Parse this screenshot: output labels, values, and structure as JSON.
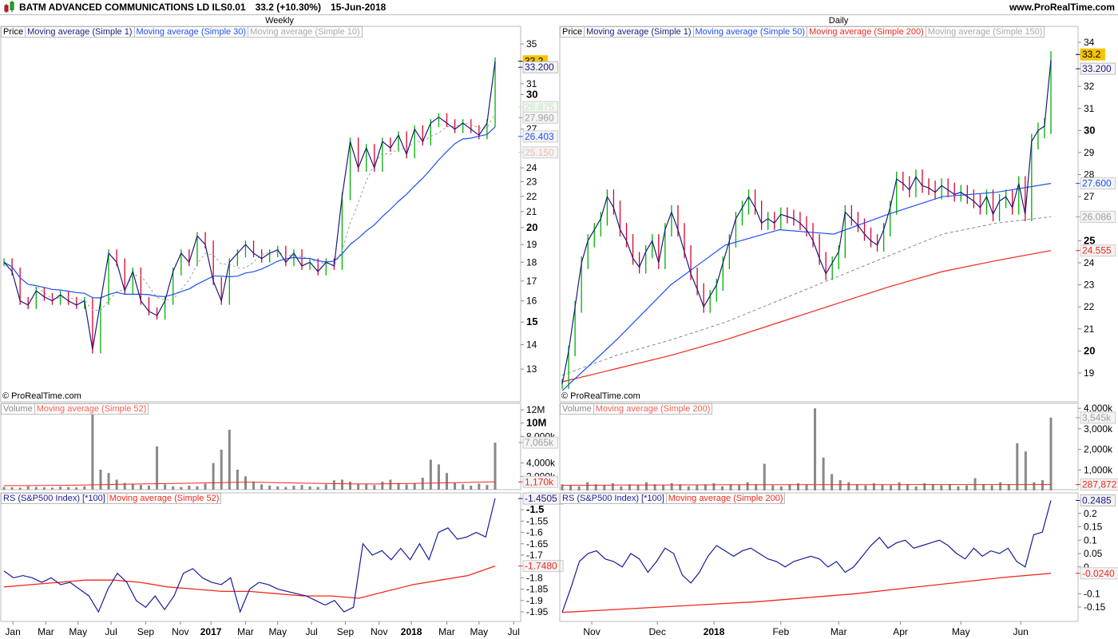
{
  "header": {
    "title": "BATM ADVANCED COMMUNICATIONS LD ILS0.01",
    "price": "33.2 (+10.30%)",
    "date": "15-Jun-2018",
    "site": "www.ProRealTime.com"
  },
  "copyright": "© ProRealTime.com",
  "colors": {
    "up": "#00b000",
    "down": "#e0002a",
    "ma1": "#1a1a80",
    "blue": "#1f4ff0",
    "red": "#f0281e",
    "gray": "#a0a0a0",
    "badge_last": "#f5c400"
  },
  "chart_data": [
    {
      "type": "line",
      "title": "Weekly",
      "legend": {
        "price": "Price",
        "ma1": "Moving average (Simple 1)",
        "ma_a": "Moving average (Simple 30)",
        "ma_b": "Moving average (Simple 10)"
      },
      "vol_legend": {
        "vol": "Volume",
        "ma": "Moving average (Simple 52)"
      },
      "rs_legend": {
        "rs": "RS (S&P500 Index) [*100]",
        "ma": "Moving average (Simple 52)"
      },
      "closes": [
        18,
        17.5,
        16,
        15.8,
        16.5,
        16.2,
        16,
        16.3,
        16,
        15.8,
        16,
        13.8,
        16,
        18.5,
        18,
        16.5,
        17.5,
        16,
        15.5,
        15.3,
        16,
        17.5,
        18.5,
        18,
        19.5,
        19,
        17,
        16,
        18,
        18.5,
        19,
        18.5,
        18.2,
        18.5,
        18.7,
        18,
        18.5,
        17.8,
        18,
        17.5,
        18,
        17.8,
        22,
        26,
        24,
        25.5,
        24,
        26,
        25.5,
        26.5,
        25,
        27,
        26,
        27.5,
        28,
        27.5,
        27,
        27.5,
        27,
        26.5,
        27.5,
        33.2
      ],
      "ma_a_window": 15,
      "ma_b_window": 5,
      "volume": [
        400,
        350,
        300,
        500,
        400,
        350,
        300,
        450,
        400,
        350,
        500,
        12000,
        3000,
        2500,
        1500,
        1000,
        900,
        700,
        600,
        6500,
        800,
        500,
        400,
        600,
        500,
        900,
        4000,
        6000,
        9000,
        3000,
        2000,
        1200,
        800,
        600,
        500,
        400,
        600,
        700,
        500,
        400,
        800,
        1400,
        1500,
        1200,
        900,
        800,
        700,
        1200,
        1500,
        1000,
        800,
        900,
        1800,
        4500,
        3800,
        2500,
        1000,
        800,
        600,
        900,
        700,
        7065
      ],
      "vol_ma": [
        600,
        600,
        620,
        650,
        700,
        750,
        800,
        850,
        900,
        950,
        1000,
        1050,
        1100,
        1100,
        1050,
        1000,
        950,
        900,
        850,
        850,
        900,
        950,
        1000,
        1050,
        1100,
        1170
      ],
      "rs": [
        -1.77,
        -1.8,
        -1.79,
        -1.8,
        -1.82,
        -1.8,
        -1.83,
        -1.82,
        -1.85,
        -1.88,
        -1.95,
        -1.85,
        -1.78,
        -1.82,
        -1.9,
        -1.93,
        -1.88,
        -1.94,
        -1.88,
        -1.78,
        -1.76,
        -1.8,
        -1.82,
        -1.83,
        -1.8,
        -1.95,
        -1.85,
        -1.82,
        -1.83,
        -1.85,
        -1.86,
        -1.87,
        -1.88,
        -1.9,
        -1.92,
        -1.9,
        -1.95,
        -1.93,
        -1.65,
        -1.7,
        -1.68,
        -1.72,
        -1.67,
        -1.72,
        -1.65,
        -1.72,
        -1.6,
        -1.58,
        -1.63,
        -1.62,
        -1.6,
        -1.62,
        -1.45
      ],
      "rs_ma": [
        -1.84,
        -1.83,
        -1.82,
        -1.81,
        -1.81,
        -1.82,
        -1.84,
        -1.85,
        -1.86,
        -1.86,
        -1.87,
        -1.88,
        -1.88,
        -1.89,
        -1.86,
        -1.83,
        -1.81,
        -1.79,
        -1.748
      ],
      "price_ticks": [
        {
          "v": 35,
          "label": "35"
        },
        {
          "v": 31,
          "label": "31"
        },
        {
          "v": 30,
          "label": "30",
          "bold": true
        },
        {
          "v": 27,
          "label": "27"
        },
        {
          "v": 24,
          "label": "24"
        },
        {
          "v": 23,
          "label": "23"
        },
        {
          "v": 22,
          "label": "22"
        },
        {
          "v": 21,
          "label": "21"
        },
        {
          "v": 20,
          "label": "20",
          "bold": true
        },
        {
          "v": 19,
          "label": "19"
        },
        {
          "v": 18,
          "label": "18"
        },
        {
          "v": 17,
          "label": "17"
        },
        {
          "v": 16,
          "label": "16"
        },
        {
          "v": 15,
          "label": "15",
          "bold": true
        },
        {
          "v": 14,
          "label": "14"
        },
        {
          "v": 13,
          "label": "13"
        }
      ],
      "vol_ticks": [
        {
          "v": 12000,
          "label": "12M"
        },
        {
          "v": 10000,
          "label": "10M",
          "bold": true
        },
        {
          "v": 8000,
          "label": "8,000k"
        },
        {
          "v": 4000,
          "label": "4,000k"
        },
        {
          "v": 2000,
          "label": "2,000k"
        }
      ],
      "rs_ticks": [
        {
          "v": -1.5,
          "label": "-1.5",
          "bold": true
        },
        {
          "v": -1.55,
          "label": "-1.55"
        },
        {
          "v": -1.6,
          "label": "-1.6"
        },
        {
          "v": -1.65,
          "label": "-1.65"
        },
        {
          "v": -1.7,
          "label": "-1.7"
        },
        {
          "v": -1.8,
          "label": "-1.8"
        },
        {
          "v": -1.85,
          "label": "-1.85"
        },
        {
          "v": -1.9,
          "label": "-1.9"
        },
        {
          "v": -1.95,
          "label": "-1.95"
        }
      ],
      "price_badges": [
        {
          "v": 33.2,
          "label": "33.2",
          "kind": "last"
        },
        {
          "v": 32.6,
          "label": "33.200",
          "kind": "ma1"
        },
        {
          "v": 28.875,
          "label": "28.875",
          "kind": "green"
        },
        {
          "v": 27.96,
          "label": "27.960",
          "kind": "gray"
        },
        {
          "v": 26.403,
          "label": "26.403",
          "kind": "blue"
        },
        {
          "v": 25.15,
          "label": "25.150",
          "kind": "pink"
        }
      ],
      "vol_badges": [
        {
          "v": 7065,
          "label": "7,065k",
          "kind": "gray"
        },
        {
          "v": 1170,
          "label": "1,170k",
          "kind": "red"
        }
      ],
      "rs_badges": [
        {
          "v": -1.4505,
          "label": "-1.4505",
          "kind": "ma1"
        },
        {
          "v": -1.748,
          "label": "-1.7480",
          "kind": "red"
        }
      ],
      "x_labels": [
        {
          "at": 1.1,
          "label": "Jan"
        },
        {
          "at": 5.2,
          "label": "Mar"
        },
        {
          "at": 9.2,
          "label": "May"
        },
        {
          "at": 13.3,
          "label": "Jul"
        },
        {
          "at": 17.6,
          "label": "Sep"
        },
        {
          "at": 21.9,
          "label": "Nov"
        },
        {
          "at": 25.7,
          "label": "2017",
          "bold": true
        },
        {
          "at": 30,
          "label": "Mar"
        },
        {
          "at": 34,
          "label": "May"
        },
        {
          "at": 38.2,
          "label": "Jul"
        },
        {
          "at": 42.4,
          "label": "Sep"
        },
        {
          "at": 46.6,
          "label": "Nov"
        },
        {
          "at": 50.6,
          "label": "2018",
          "bold": true
        },
        {
          "at": 55,
          "label": "Mar"
        },
        {
          "at": 59,
          "label": "May"
        },
        {
          "at": 63.3,
          "label": "Jul"
        }
      ]
    },
    {
      "type": "line",
      "title": "Daily",
      "legend": {
        "price": "Price",
        "ma1": "Moving average (Simple 1)",
        "ma_a": "Moving average (Simple 50)",
        "ma_c": "Moving average (Simple 200)",
        "ma_b": "Moving average (Simple 150)"
      },
      "vol_legend": {
        "vol": "Volume",
        "ma": "Moving average (Simple 200)"
      },
      "rs_legend": {
        "rs": "RS (S&P500 Index) [*100]",
        "ma": "Moving average (Simple 200)"
      },
      "closes": [
        18.5,
        20,
        22,
        24,
        25,
        25.5,
        26,
        27,
        26.5,
        25.5,
        25,
        24.2,
        23.8,
        24.5,
        25,
        24,
        25.5,
        26.3,
        25.5,
        24.5,
        23.5,
        22.8,
        22,
        22.5,
        23,
        24,
        25,
        26,
        26.5,
        27,
        26.5,
        25.8,
        26,
        25.8,
        26.2,
        26.1,
        26,
        25.8,
        25.5,
        25,
        24.2,
        23.5,
        24,
        24.5,
        26.3,
        26,
        25.7,
        25.3,
        25,
        24.8,
        25.5,
        26.5,
        27.8,
        27.6,
        27.3,
        27.9,
        27.5,
        27.4,
        27.2,
        27.5,
        27.3,
        27.1,
        27.2,
        27,
        26.8,
        26.5,
        27,
        26.2,
        26.8,
        27,
        26.5,
        27.6,
        26.2,
        29.5,
        30,
        30.2,
        33.2
      ],
      "ma_a": [
        18.2,
        20.5,
        23,
        24.8,
        25.5,
        25.3,
        26.2,
        27.0,
        27.2,
        27.6
      ],
      "ma_b": [
        18.9,
        19.8,
        20.5,
        21.3,
        22.3,
        23.3,
        24.3,
        25.3,
        25.8,
        26.086
      ],
      "ma_c": [
        18.6,
        19.2,
        19.8,
        20.5,
        21.3,
        22.1,
        22.9,
        23.6,
        24.1,
        24.555
      ],
      "volume": [
        300,
        250,
        200,
        400,
        300,
        250,
        350,
        200,
        300,
        250,
        400,
        300,
        250,
        350,
        300,
        200,
        250,
        300,
        350,
        200,
        300,
        250,
        400,
        300,
        1300,
        250,
        200,
        300,
        350,
        300,
        4000,
        1600,
        800,
        500,
        400,
        300,
        250,
        350,
        300,
        250,
        400,
        300,
        200,
        350,
        300,
        250,
        300,
        200,
        250,
        600,
        300,
        250,
        400,
        300,
        2300,
        1900,
        400,
        500,
        3545
      ],
      "vol_ma": [
        250,
        260,
        270,
        275,
        280,
        282,
        285,
        286,
        287,
        287.872
      ],
      "rs": [
        -0.17,
        -0.08,
        0.02,
        0.05,
        0.06,
        0.03,
        0.02,
        0.0,
        0.05,
        0.03,
        -0.02,
        0.02,
        0.07,
        0.05,
        -0.03,
        -0.06,
        -0.02,
        0.04,
        0.08,
        0.06,
        0.04,
        0.06,
        0.07,
        0.05,
        0.03,
        0.02,
        0.0,
        0.02,
        0.03,
        0.04,
        0.03,
        0.0,
        0.02,
        -0.02,
        0.0,
        0.04,
        0.08,
        0.11,
        0.07,
        0.09,
        0.1,
        0.07,
        0.08,
        0.09,
        0.1,
        0.08,
        0.05,
        0.03,
        0.07,
        0.04,
        0.06,
        0.05,
        0.07,
        0.02,
        0.0,
        0.12,
        0.13,
        0.2485
      ],
      "rs_ma": [
        -0.17,
        -0.16,
        -0.15,
        -0.14,
        -0.13,
        -0.115,
        -0.1,
        -0.08,
        -0.06,
        -0.04,
        -0.024
      ],
      "price_ticks": [
        {
          "v": 34,
          "label": "34"
        },
        {
          "v": 32,
          "label": "32"
        },
        {
          "v": 31,
          "label": "31"
        },
        {
          "v": 30,
          "label": "30",
          "bold": true
        },
        {
          "v": 29,
          "label": "29"
        },
        {
          "v": 28,
          "label": "28"
        },
        {
          "v": 27,
          "label": "27"
        },
        {
          "v": 25,
          "label": "25",
          "bold": true
        },
        {
          "v": 24,
          "label": "24"
        },
        {
          "v": 23,
          "label": "23"
        },
        {
          "v": 22,
          "label": "22"
        },
        {
          "v": 21,
          "label": "21"
        },
        {
          "v": 20,
          "label": "20",
          "bold": true
        },
        {
          "v": 19,
          "label": "19"
        }
      ],
      "vol_ticks": [
        {
          "v": 4000,
          "label": "4,000k"
        },
        {
          "v": 3000,
          "label": "3,000k"
        },
        {
          "v": 2000,
          "label": "2,000k"
        },
        {
          "v": 1000,
          "label": "1,000k"
        }
      ],
      "rs_ticks": [
        {
          "v": 0.2,
          "label": "0.2"
        },
        {
          "v": 0.15,
          "label": "0.15"
        },
        {
          "v": 0.1,
          "label": "0.1"
        },
        {
          "v": 0.05,
          "label": "0.05"
        },
        {
          "v": 0,
          "label": "0"
        },
        {
          "v": -0.1,
          "label": "-0.1"
        },
        {
          "v": -0.15,
          "label": "-0.15"
        }
      ],
      "price_badges": [
        {
          "v": 33.45,
          "label": "33.2",
          "kind": "last"
        },
        {
          "v": 32.8,
          "label": "33.200",
          "kind": "ma1"
        },
        {
          "v": 27.6,
          "label": "27.600",
          "kind": "blue"
        },
        {
          "v": 26.086,
          "label": "26.086",
          "kind": "gray"
        },
        {
          "v": 24.555,
          "label": "24.555",
          "kind": "red"
        }
      ],
      "vol_badges": [
        {
          "v": 3545,
          "label": "3,545k",
          "kind": "gray"
        },
        {
          "v": 287.872,
          "label": "287,872",
          "kind": "red"
        }
      ],
      "rs_badges": [
        {
          "v": 0.2485,
          "label": "0.2485",
          "kind": "ma1"
        },
        {
          "v": -0.024,
          "label": "-0.0240",
          "kind": "red"
        }
      ],
      "x_labels": [
        {
          "at": 4.6,
          "label": "Nov"
        },
        {
          "at": 14.8,
          "label": "Dec"
        },
        {
          "at": 23.6,
          "label": "2018",
          "bold": true
        },
        {
          "at": 34,
          "label": "Feb"
        },
        {
          "at": 43,
          "label": "Mar"
        },
        {
          "at": 52.6,
          "label": "Apr"
        },
        {
          "at": 62,
          "label": "May"
        },
        {
          "at": 71.3,
          "label": "Jun"
        }
      ]
    }
  ]
}
